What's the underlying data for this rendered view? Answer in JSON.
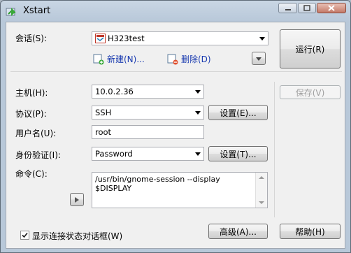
{
  "window": {
    "title": "Xstart",
    "icon": "xstart-app-icon",
    "controls": [
      "minimize-icon",
      "maximize-icon",
      "close-icon"
    ]
  },
  "session": {
    "label": "会话(S):",
    "value": "H323test",
    "new_link": "新建(N)...",
    "delete_link": "删除(D)"
  },
  "buttons": {
    "run": "运行(R)",
    "save": "保存(V)",
    "settings_protocol": "设置(E)...",
    "settings_auth": "设置(T)...",
    "advanced": "高级(A)...",
    "help": "帮助(H)"
  },
  "form": {
    "host_label": "主机(H):",
    "host_value": "10.0.2.36",
    "protocol_label": "协议(P):",
    "protocol_value": "SSH",
    "username_label": "用户名(U):",
    "username_value": "root",
    "auth_label": "身份验证(I):",
    "auth_value": "Password",
    "command_label": "命令(C):",
    "command_value": "/usr/bin/gnome-session --display $DISPLAY"
  },
  "options": {
    "show_status_label": "显示连接状态对话框(W)",
    "show_status_checked": true
  }
}
